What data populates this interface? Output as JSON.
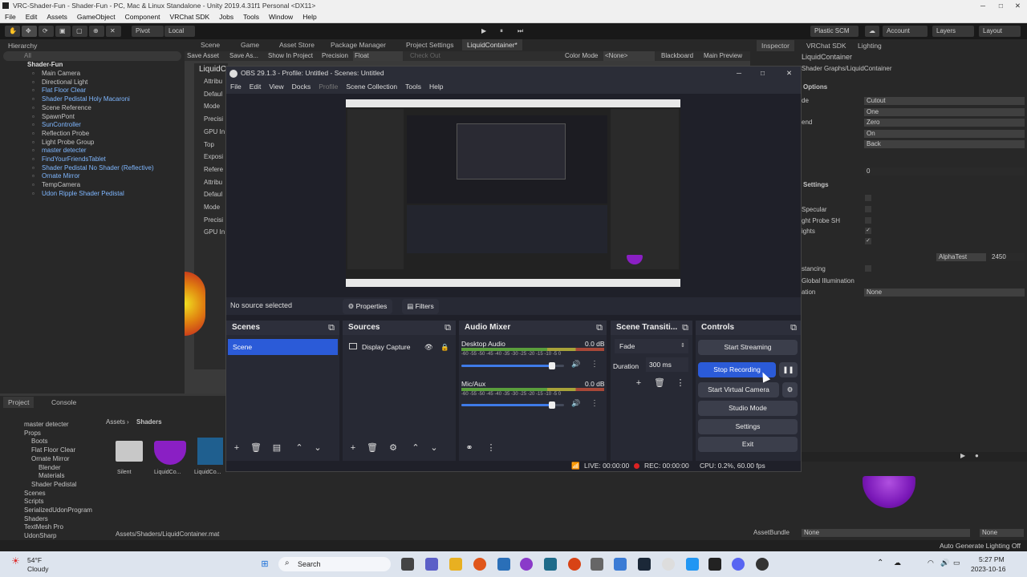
{
  "unity": {
    "title": "VRC-Shader-Fun - Shader-Fun - PC, Mac & Linux Standalone - Unity 2019.4.31f1 Personal <DX11>",
    "menu": [
      "File",
      "Edit",
      "Assets",
      "GameObject",
      "Component",
      "VRChat SDK",
      "Jobs",
      "Tools",
      "Window",
      "Help"
    ],
    "toolbar": {
      "pivot": "Pivot",
      "local": "Local",
      "plastic": "Plastic SCM",
      "account": "Account",
      "layers": "Layers",
      "layout": "Layout"
    },
    "hierarchy": {
      "tab": "Hierarchy",
      "search_placeholder": "All",
      "root": "Shader-Fun",
      "items": [
        {
          "label": "Main Camera",
          "blue": false
        },
        {
          "label": "Directional Light",
          "blue": false
        },
        {
          "label": "Flat Floor Clear",
          "blue": true
        },
        {
          "label": "Shader Pedistal Holy Macaroni",
          "blue": true
        },
        {
          "label": "Scene Reference",
          "blue": false
        },
        {
          "label": "SpawnPont",
          "blue": false
        },
        {
          "label": "SunController",
          "blue": true
        },
        {
          "label": "Reflection Probe",
          "blue": false
        },
        {
          "label": "Light Probe Group",
          "blue": false
        },
        {
          "label": "master detecter",
          "blue": true
        },
        {
          "label": "FindYourFriendsTablet",
          "blue": true
        },
        {
          "label": "Shader Pedistal No Shader (Reflective)",
          "blue": true
        },
        {
          "label": "Ornate Mirror",
          "blue": true
        },
        {
          "label": "TempCamera",
          "blue": false
        },
        {
          "label": "Udon Ripple Shader Pedistal",
          "blue": true
        }
      ]
    },
    "scene_tabs": [
      "Scene",
      "Game",
      "Asset Store",
      "Package Manager",
      "Project Settings",
      "LiquidContainer*"
    ],
    "shader_toolbar": {
      "save_asset": "Save Asset",
      "save_as": "Save As...",
      "show_in_project": "Show In Project",
      "precision_label": "Precision",
      "precision_value": "Float",
      "check_out": "Check Out",
      "color_mode_label": "Color Mode",
      "color_mode_value": "<None>",
      "blackboard": "Blackboard",
      "main_preview": "Main Preview"
    },
    "shader_panel": {
      "title": "LiquidC",
      "rows": [
        "Attribu",
        "Defaul",
        "Mode",
        "Precisi",
        "GPU In",
        "Top",
        "Exposi",
        "Refere",
        "Attribu",
        "Defaul",
        "Mode",
        "Precisi",
        "GPU In"
      ]
    },
    "inspector": {
      "tabs": [
        "Inspector",
        "VRChat SDK",
        "Lighting"
      ],
      "object": "LiquidContainer",
      "shader": "Shader Graphs/LiquidContainer",
      "options_header": "Options",
      "options": [
        {
          "label": "de",
          "value": "Cutout"
        },
        {
          "label": "",
          "value": "One"
        },
        {
          "label": "end",
          "value": "Zero"
        },
        {
          "label": "",
          "value": "On"
        },
        {
          "label": "",
          "value": "Back"
        }
      ],
      "zero_value": "0",
      "settings_header": "Settings",
      "settings": [
        "Specular",
        "ght Probe SH",
        "ights"
      ],
      "alpha_test": "AlphaTest",
      "alpha_value": "2450",
      "instancing": "stancing",
      "gi": "Global Illumination",
      "gi_value": "None",
      "ation": "ation",
      "asset_bundle": "AssetBundle",
      "bundle_value": "None",
      "bundle_variant": "None"
    },
    "project": {
      "tabs": [
        "Project",
        "Console"
      ],
      "breadcrumb": [
        "Assets",
        "Shaders"
      ],
      "tree": [
        "master detecter",
        "Props",
        "Boots",
        "Flat Floor Clear",
        "Ornate Mirror",
        "Blender",
        "Materials",
        "Shader Pedistal",
        "Scenes",
        "Scripts",
        "SerializedUdonProgram",
        "Shaders",
        "TextMesh Pro",
        "UdonSharp"
      ],
      "assets": [
        "Silent",
        "LiquidCo...",
        "LiquidCo..."
      ],
      "path": "Assets/Shaders/LiquidContainer.mat"
    },
    "status_right": "Auto Generate Lighting Off"
  },
  "obs": {
    "title": "OBS 29.1.3 - Profile: Untitled - Scenes: Untitled",
    "menu": [
      "File",
      "Edit",
      "View",
      "Docks",
      "Profile",
      "Scene Collection",
      "Tools",
      "Help"
    ],
    "no_source": "No source selected",
    "properties": "Properties",
    "filters": "Filters",
    "scenes": {
      "header": "Scenes",
      "items": [
        "Scene"
      ]
    },
    "sources": {
      "header": "Sources",
      "items": [
        "Display Capture"
      ]
    },
    "mixer": {
      "header": "Audio Mixer",
      "channels": [
        {
          "name": "Desktop Audio",
          "db": "0.0 dB",
          "level": 0.88
        },
        {
          "name": "Mic/Aux",
          "db": "0.0 dB",
          "level": 0.88
        }
      ],
      "scale": "-60 -55 -50 -45 -40 -35 -30 -25 -20 -15 -10 -5 0"
    },
    "transitions": {
      "header": "Scene Transiti...",
      "type": "Fade",
      "duration_label": "Duration",
      "duration_value": "300 ms"
    },
    "controls": {
      "header": "Controls",
      "start_streaming": "Start Streaming",
      "stop_recording": "Stop Recording",
      "start_virtual": "Start Virtual Camera",
      "studio_mode": "Studio Mode",
      "settings": "Settings",
      "exit": "Exit"
    },
    "status": {
      "live": "LIVE: 00:00:00",
      "rec": "REC: 00:00:00",
      "cpu": "CPU: 0.2%, 60.00 fps"
    }
  },
  "taskbar": {
    "temp": "54°F",
    "weather": "Cloudy",
    "search": "Search",
    "time": "5:27 PM",
    "date": "2023-10-16"
  }
}
